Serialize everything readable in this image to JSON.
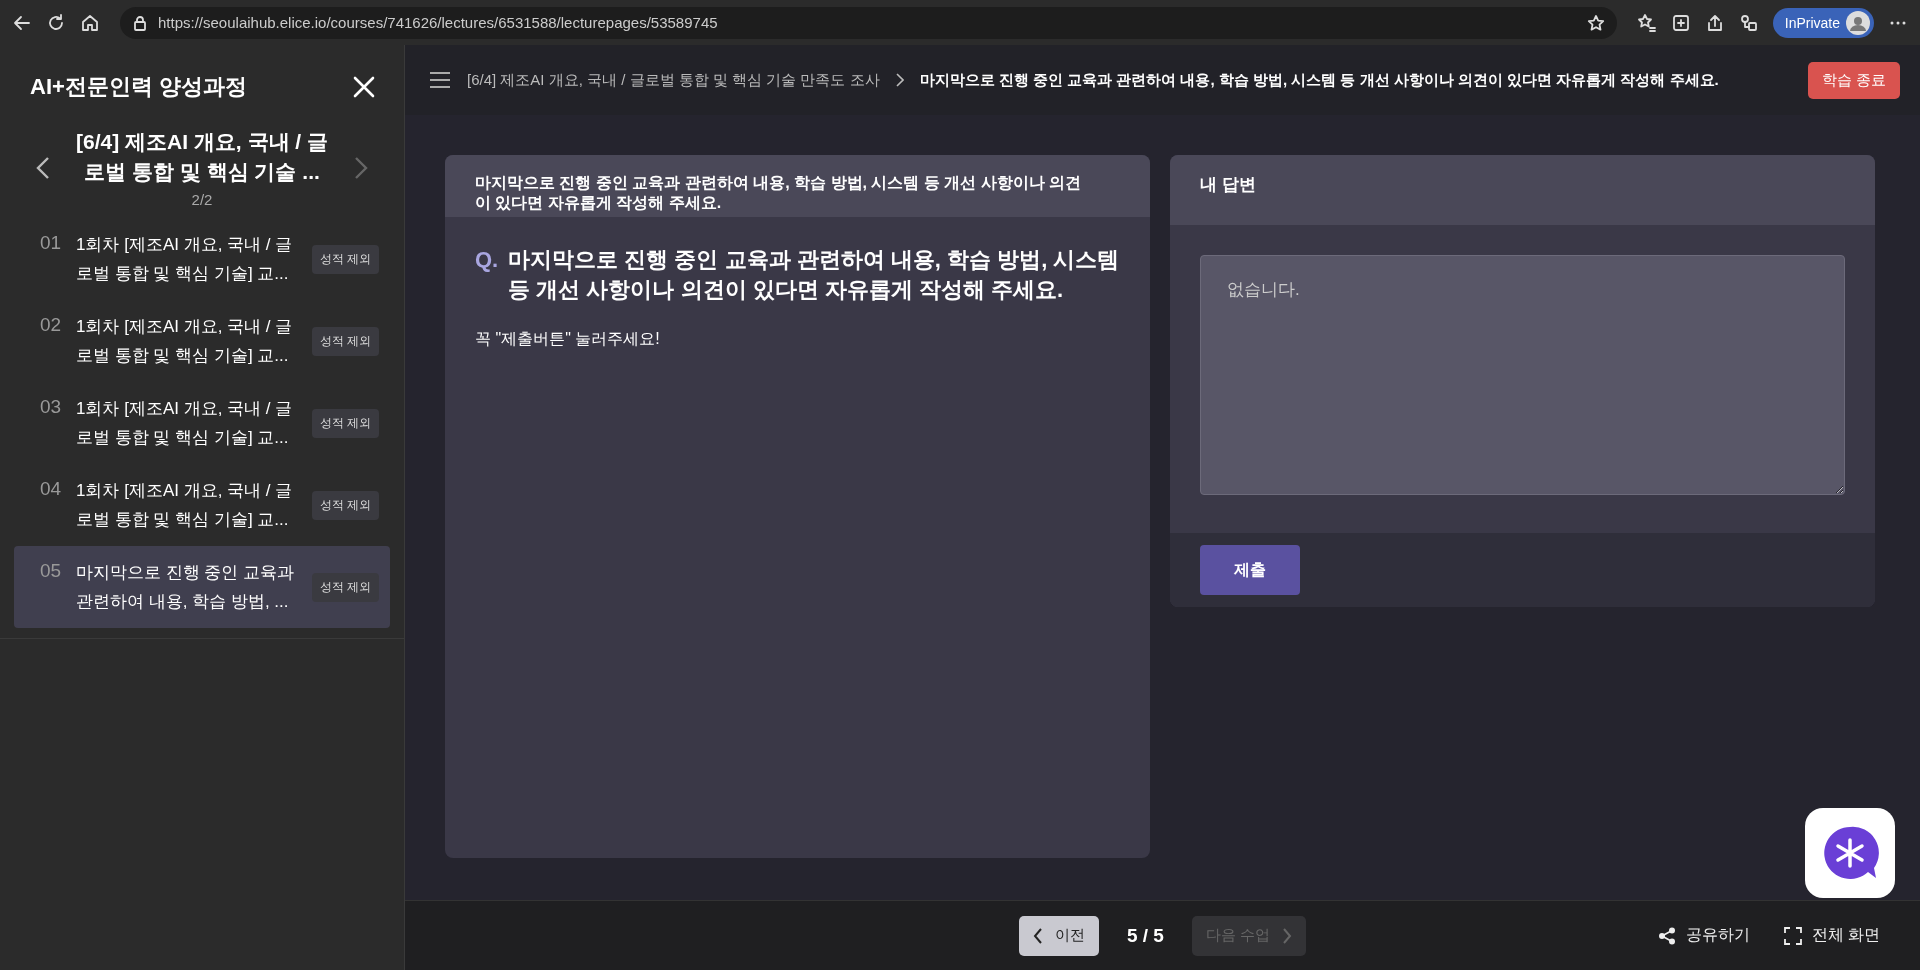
{
  "browser": {
    "url": "https://seoulaihub.elice.io/courses/741626/lectures/6531588/lecturepages/53589745",
    "profile": "InPrivate"
  },
  "sidebar": {
    "title": "AI+전문인력 양성과정",
    "course_title": "[6/4] 제조AI 개요, 국내 / 글로벌 통합 및 핵심 기술 ...",
    "page": "2/2",
    "prev_disabled": false,
    "next_disabled": true,
    "items": [
      {
        "number": "01",
        "title": "1회차 [제조AI 개요, 국내 / 글로벌 통합 및 핵심 기술] 교...",
        "badge": "성적 제외",
        "selected": false
      },
      {
        "number": "02",
        "title": "1회차 [제조AI 개요, 국내 / 글로벌 통합 및 핵심 기술] 교...",
        "badge": "성적 제외",
        "selected": false
      },
      {
        "number": "03",
        "title": "1회차 [제조AI 개요, 국내 / 글로벌 통합 및 핵심 기술] 교...",
        "badge": "성적 제외",
        "selected": false
      },
      {
        "number": "04",
        "title": "1회차 [제조AI 개요, 국내 / 글로벌 통합 및 핵심 기술] 교...",
        "badge": "성적 제외",
        "selected": false
      },
      {
        "number": "05",
        "title": "마지막으로 진행 중인 교육과 관련하여 내용, 학습 방법, ...",
        "badge": "성적 제외",
        "selected": true
      }
    ]
  },
  "header": {
    "breadcrumb": "[6/4] 제조AI 개요, 국내 / 글로벌 통합 및 핵심 기술 만족도 조사",
    "current": "마지막으로 진행 중인 교육과 관련하여 내용, 학습 방법, 시스템 등 개선 사항이나 의견이 있다면 자유롭게 작성해 주세요.",
    "end_button": "학습 종료"
  },
  "question_card": {
    "header": "마지막으로 진행 중인 교육과 관련하여 내용, 학습 방법, 시스템 등 개선 사항이나 의견이 있다면 자유롭게 작성해 주세요.",
    "marker": "Q.",
    "question": "마지막으로 진행 중인 교육과 관련하여 내용, 학습 방법, 시스템 등 개선 사항이나 의견이 있다면 자유롭게 작성해 주세요.",
    "note": "꼭 \"제출버튼\" 눌러주세요!"
  },
  "answer_card": {
    "header": "내 답변",
    "answer": "없습니다.",
    "submit": "제출"
  },
  "footer": {
    "prev": "이전",
    "page": "5 / 5",
    "next": "다음 수업",
    "next_disabled": true,
    "share": "공유하기",
    "fullscreen": "전체 화면"
  }
}
